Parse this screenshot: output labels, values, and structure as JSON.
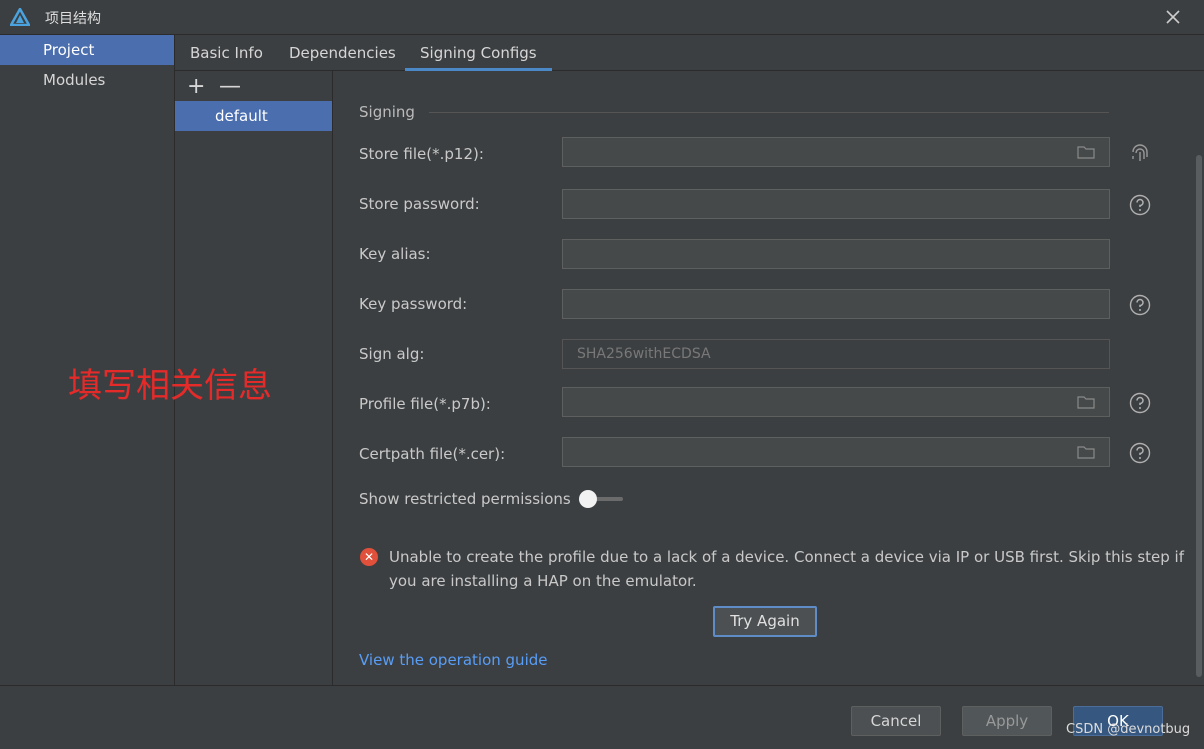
{
  "window": {
    "title": "项目结构"
  },
  "nav": {
    "items": [
      {
        "label": "Project"
      },
      {
        "label": "Modules"
      }
    ]
  },
  "annotation": {
    "text": "填写相关信息"
  },
  "tabs": [
    {
      "label": "Basic Info"
    },
    {
      "label": "Dependencies"
    },
    {
      "label": "Signing Configs"
    }
  ],
  "configs": {
    "add": "+",
    "remove": "—",
    "items": [
      {
        "label": "default"
      }
    ]
  },
  "form": {
    "section_title": "Signing",
    "fields": [
      {
        "label": "Store file(*.p12):",
        "value": ""
      },
      {
        "label": "Store password:",
        "value": ""
      },
      {
        "label": "Key alias:",
        "value": ""
      },
      {
        "label": "Key password:",
        "value": ""
      },
      {
        "label": "Sign alg:",
        "value": "SHA256withECDSA"
      },
      {
        "label": "Profile file(*.p7b):",
        "value": ""
      },
      {
        "label": "Certpath file(*.cer):",
        "value": ""
      }
    ],
    "show_restricted_label": "Show restricted permissions",
    "show_restricted_on": false
  },
  "error": {
    "message": "Unable to create the profile due to a lack of a device. Connect a device via IP or USB first. Skip this step if you are installing a HAP on the emulator.",
    "try_again": "Try Again"
  },
  "guide_link": "View the operation guide",
  "footer": {
    "cancel": "Cancel",
    "apply": "Apply",
    "ok": "OK",
    "watermark": "CSDN @devnotbug"
  },
  "colors": {
    "selection": "#4b6eaf",
    "link": "#589df6",
    "error": "#e0503b",
    "annotation": "#e52a2a"
  }
}
